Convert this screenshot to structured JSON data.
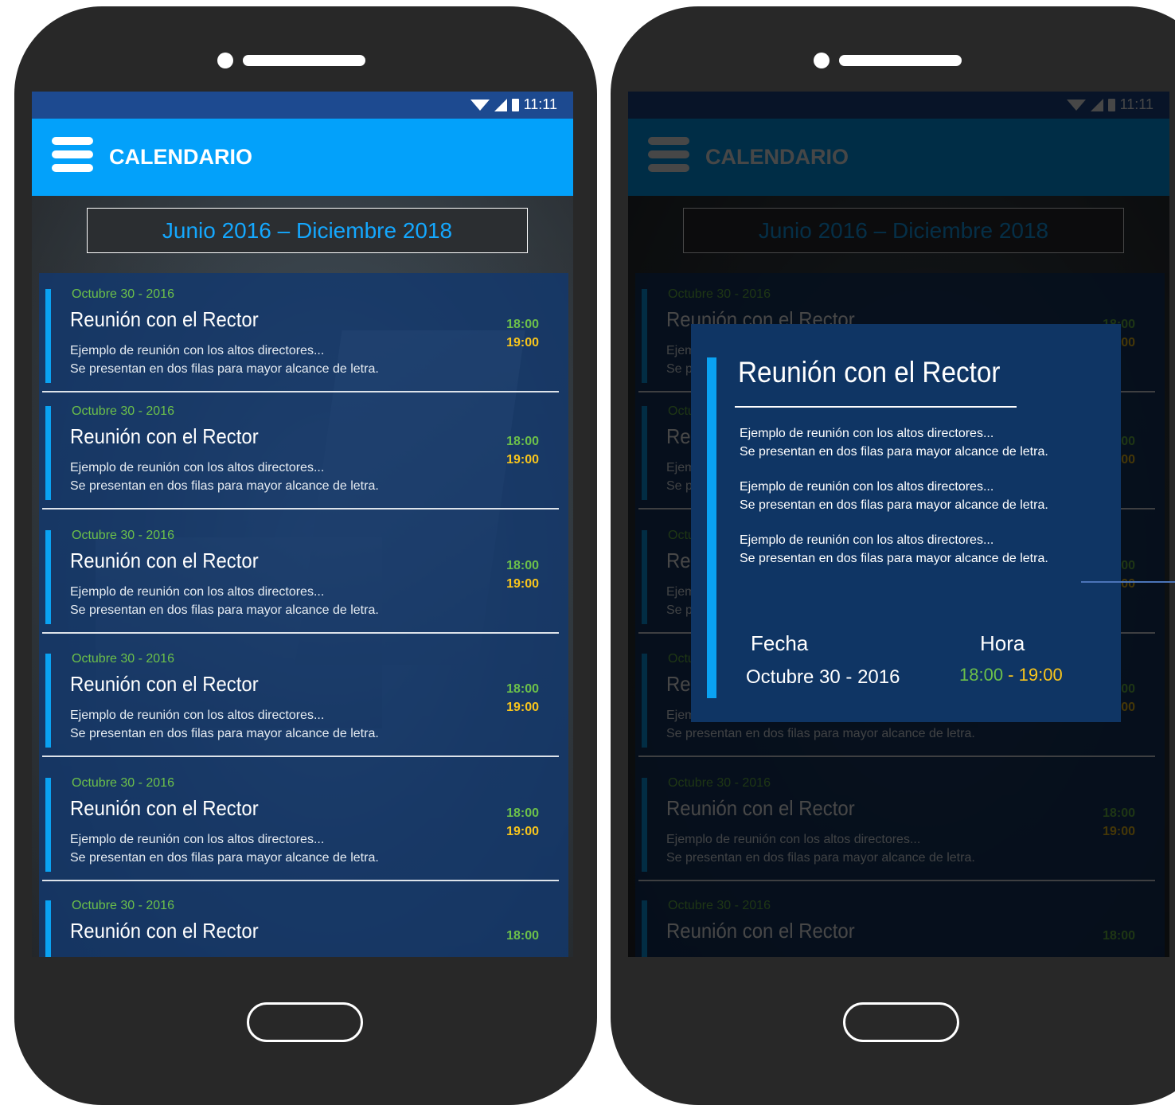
{
  "status_bar": {
    "time": "11:11"
  },
  "app_bar": {
    "title": "CALENDARIO"
  },
  "date_range": "Junio 2016 – Diciembre 2018",
  "events": [
    {
      "date": "Octubre 30 - 2016",
      "title": "Reunión con el Rector",
      "desc_line1": "Ejemplo de reunión con los altos directores...",
      "desc_line2": "Se presentan en dos filas para mayor alcance de letra.",
      "start": "18:00",
      "end": "19:00"
    },
    {
      "date": "Octubre 30 - 2016",
      "title": "Reunión con el Rector",
      "desc_line1": "Ejemplo de reunión con los altos directores...",
      "desc_line2": "Se presentan en dos filas para mayor alcance de letra.",
      "start": "18:00",
      "end": "19:00"
    },
    {
      "date": "Octubre 30 - 2016",
      "title": "Reunión con el Rector",
      "desc_line1": "Ejemplo de reunión con los altos directores...",
      "desc_line2": "Se presentan en dos filas para mayor alcance de letra.",
      "start": "18:00",
      "end": "19:00"
    },
    {
      "date": "Octubre 30 - 2016",
      "title": "Reunión con el Rector",
      "desc_line1": "Ejemplo de reunión con los altos directores...",
      "desc_line2": "Se presentan en dos filas para mayor alcance de letra.",
      "start": "18:00",
      "end": "19:00"
    },
    {
      "date": "Octubre 30 - 2016",
      "title": "Reunión con el Rector",
      "desc_line1": "Ejemplo de reunión con los altos directores...",
      "desc_line2": "Se presentan en dos filas para mayor alcance de letra.",
      "start": "18:00",
      "end": "19:00"
    },
    {
      "date": "Octubre 30 - 2016",
      "title": "Reunión con el Rector",
      "desc_line1": "",
      "desc_line2": "",
      "start": "18:00",
      "end": ""
    }
  ],
  "dialog": {
    "title": "Reunión con el Rector",
    "paragraphs": [
      {
        "line1": "Ejemplo de reunión con los altos directores...",
        "line2": "Se presentan en dos filas para mayor alcance de letra."
      },
      {
        "line1": "Ejemplo de reunión con los altos directores...",
        "line2": "Se presentan en dos filas para mayor alcance de letra."
      },
      {
        "line1": "Ejemplo de reunión con los altos directores...",
        "line2": "Se presentan en dos filas para mayor alcance de letra."
      }
    ],
    "date_label": "Fecha",
    "time_label": "Hora",
    "date_value": "Octubre 30 - 2016",
    "time_start": "18:00",
    "time_separator": " - ",
    "time_end": "19:00"
  },
  "colors": {
    "app_bar": "#03a1fa",
    "status_bar": "#1d4a90",
    "accent": "#0aa2f2",
    "start_time": "#6cc04a",
    "end_time": "#f8c51c",
    "dialog_bg": "#0f3564"
  },
  "icons": {
    "menu": "hamburger-menu-icon",
    "wifi": "wifi-icon",
    "signal": "signal-icon",
    "battery": "battery-icon"
  }
}
